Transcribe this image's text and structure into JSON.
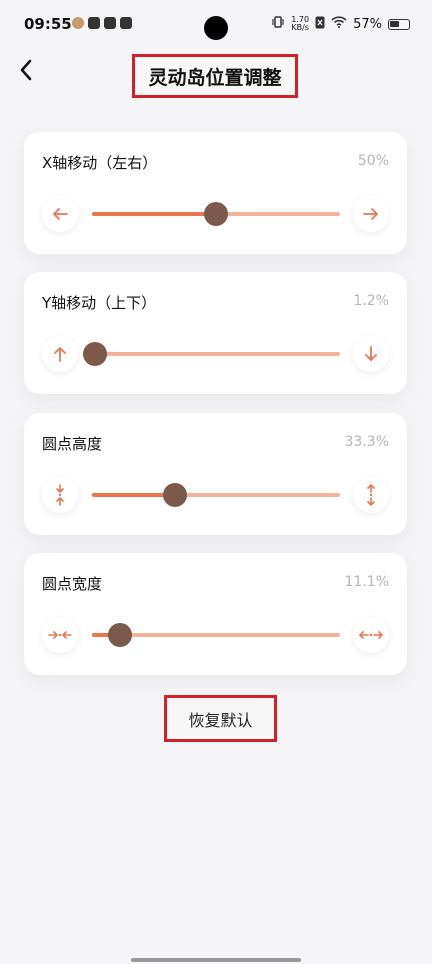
{
  "status_bar": {
    "time": "09:55",
    "net_speed_value": "1.70",
    "net_speed_unit": "KB/s",
    "battery": "57%"
  },
  "header": {
    "title": "灵动岛位置调整"
  },
  "sliders": [
    {
      "label": "X轴移动（左右）",
      "value_text": "50%",
      "value": 0.5
    },
    {
      "label": "Y轴移动（上下）",
      "value_text": "1.2%",
      "value": 0.012
    },
    {
      "label": "圆点高度",
      "value_text": "33.3%",
      "value": 0.333
    },
    {
      "label": "圆点宽度",
      "value_text": "11.1%",
      "value": 0.111
    }
  ],
  "reset_label": "恢复默认",
  "colors": {
    "accent": "#e8764e",
    "track": "#f2b39a",
    "thumb": "#7b5a4b",
    "highlight_border": "#d42028"
  }
}
